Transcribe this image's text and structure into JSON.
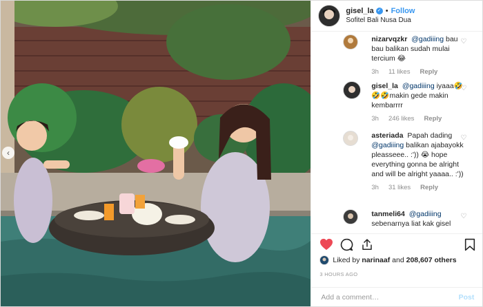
{
  "post": {
    "username": "gisel_la",
    "follow_label": "Follow",
    "separator": "•",
    "location": "Sofitel Bali Nusa Dua"
  },
  "comments": [
    {
      "user": "nizarvqzkr",
      "mention": "@gadiiing",
      "text": "bau bau balikan sudah mulai tercium 😂",
      "time": "3h",
      "likes": "11 likes",
      "reply": "Reply",
      "avatar_color": "#c9a06b"
    },
    {
      "user": "gisel_la",
      "mention": "@gadiiing",
      "text": "iyaaa🤣🤣🤣makin gede makin kembarrrr",
      "time": "3h",
      "likes": "246 likes",
      "reply": "Reply",
      "avatar_color": "#2e2e2e"
    },
    {
      "user": "asteriada",
      "mention": "@gadiiing",
      "pre": "Papah dading",
      "text": "balikan ajabayokk pleasseee.. :')) 😭 hope everything gonna be alright and will be alright yaaaa.. :'))",
      "time": "3h",
      "likes": "31 likes",
      "reply": "Reply",
      "avatar_color": "#e6ddd2"
    },
    {
      "user": "tanmeli64",
      "mention": "@gadiiing",
      "text": "sebenarnya liat kak gisel",
      "time": "",
      "likes": "",
      "reply": "",
      "avatar_color": "#3b3b3b"
    }
  ],
  "likes": {
    "liked_by_label": "Liked by",
    "liker": "narinaaf",
    "and_label": "and",
    "others": "208,607 others"
  },
  "timestamp": "3 HOURS AGO",
  "add_comment": {
    "placeholder": "Add a comment…",
    "post_label": "Post"
  },
  "icons": {
    "like": "heart-filled-icon",
    "comment": "comment-bubble-icon",
    "share": "share-icon",
    "save": "bookmark-icon",
    "verified": "verified-badge-icon",
    "carousel_prev": "chevron-left-icon"
  },
  "colors": {
    "accent": "#3897f0",
    "heart": "#ed4956",
    "post_disabled": "#b2dffc",
    "muted": "#8e8e8e"
  }
}
